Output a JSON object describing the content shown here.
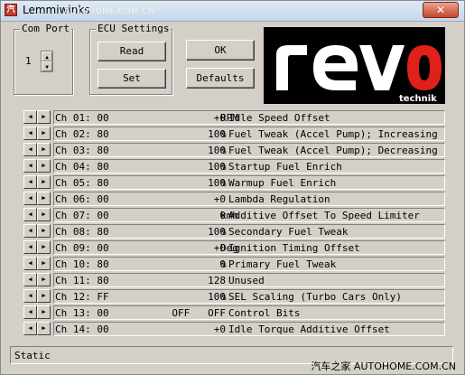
{
  "window": {
    "title": "Lemmiwinks",
    "watermark": "AUTOHOME.COM.CN",
    "close_label": "✕"
  },
  "com_port": {
    "label": "Com Port",
    "value": "1"
  },
  "ecu_settings": {
    "label": "ECU Settings",
    "read_label": "Read",
    "set_label": "Set"
  },
  "buttons": {
    "ok_label": "OK",
    "defaults_label": "Defaults"
  },
  "logo": {
    "text": "revo",
    "subtext": "technik",
    "colors": {
      "background": "#000000",
      "letters": "#ffffff",
      "accent": "#e0201a"
    }
  },
  "channels": [
    {
      "ch": "Ch 01: 00",
      "value": "+0",
      "unit": "RPM",
      "desc": "Idle Speed Offset"
    },
    {
      "ch": "Ch 02: 80",
      "value": "100",
      "unit": "%",
      "desc": "Fuel Tweak (Accel Pump); Increasing"
    },
    {
      "ch": "Ch 03: 80",
      "value": "100",
      "unit": "%",
      "desc": "Fuel Tweak (Accel Pump); Decreasing"
    },
    {
      "ch": "Ch 04: 80",
      "value": "100",
      "unit": "%",
      "desc": "Startup Fuel Enrich"
    },
    {
      "ch": "Ch 05: 80",
      "value": "100",
      "unit": "%",
      "desc": "Warmup Fuel Enrich"
    },
    {
      "ch": "Ch 06: 00",
      "value": "+0",
      "unit": "",
      "desc": "Lambda Regulation"
    },
    {
      "ch": "Ch 07: 00",
      "value": "0",
      "unit": "kmh",
      "desc": "Additive Offset To Speed Limiter"
    },
    {
      "ch": "Ch 08: 80",
      "value": "100",
      "unit": "%",
      "desc": "Secondary Fuel Tweak"
    },
    {
      "ch": "Ch 09: 00",
      "value": "+0",
      "unit": "Deg",
      "desc": "Ignition Timing Offset"
    },
    {
      "ch": "Ch 10: 80",
      "value": "0",
      "unit": "%",
      "desc": "Primary Fuel Tweak"
    },
    {
      "ch": "Ch 11: 80",
      "value": "128",
      "unit": "",
      "desc": "Unused"
    },
    {
      "ch": "Ch 12: FF",
      "value": "100",
      "unit": "%",
      "desc": "SEL Scaling (Turbo Cars Only)"
    },
    {
      "ch": "Ch 13: 00",
      "value": "OFF   OFF",
      "unit": "",
      "desc": "Control Bits"
    },
    {
      "ch": "Ch 14: 00",
      "value": "+0",
      "unit": "",
      "desc": "Idle Torque Additive Offset"
    }
  ],
  "status": {
    "text": "Static"
  },
  "footer_watermark": "汽车之家 AUTOHOME.COM.CN"
}
